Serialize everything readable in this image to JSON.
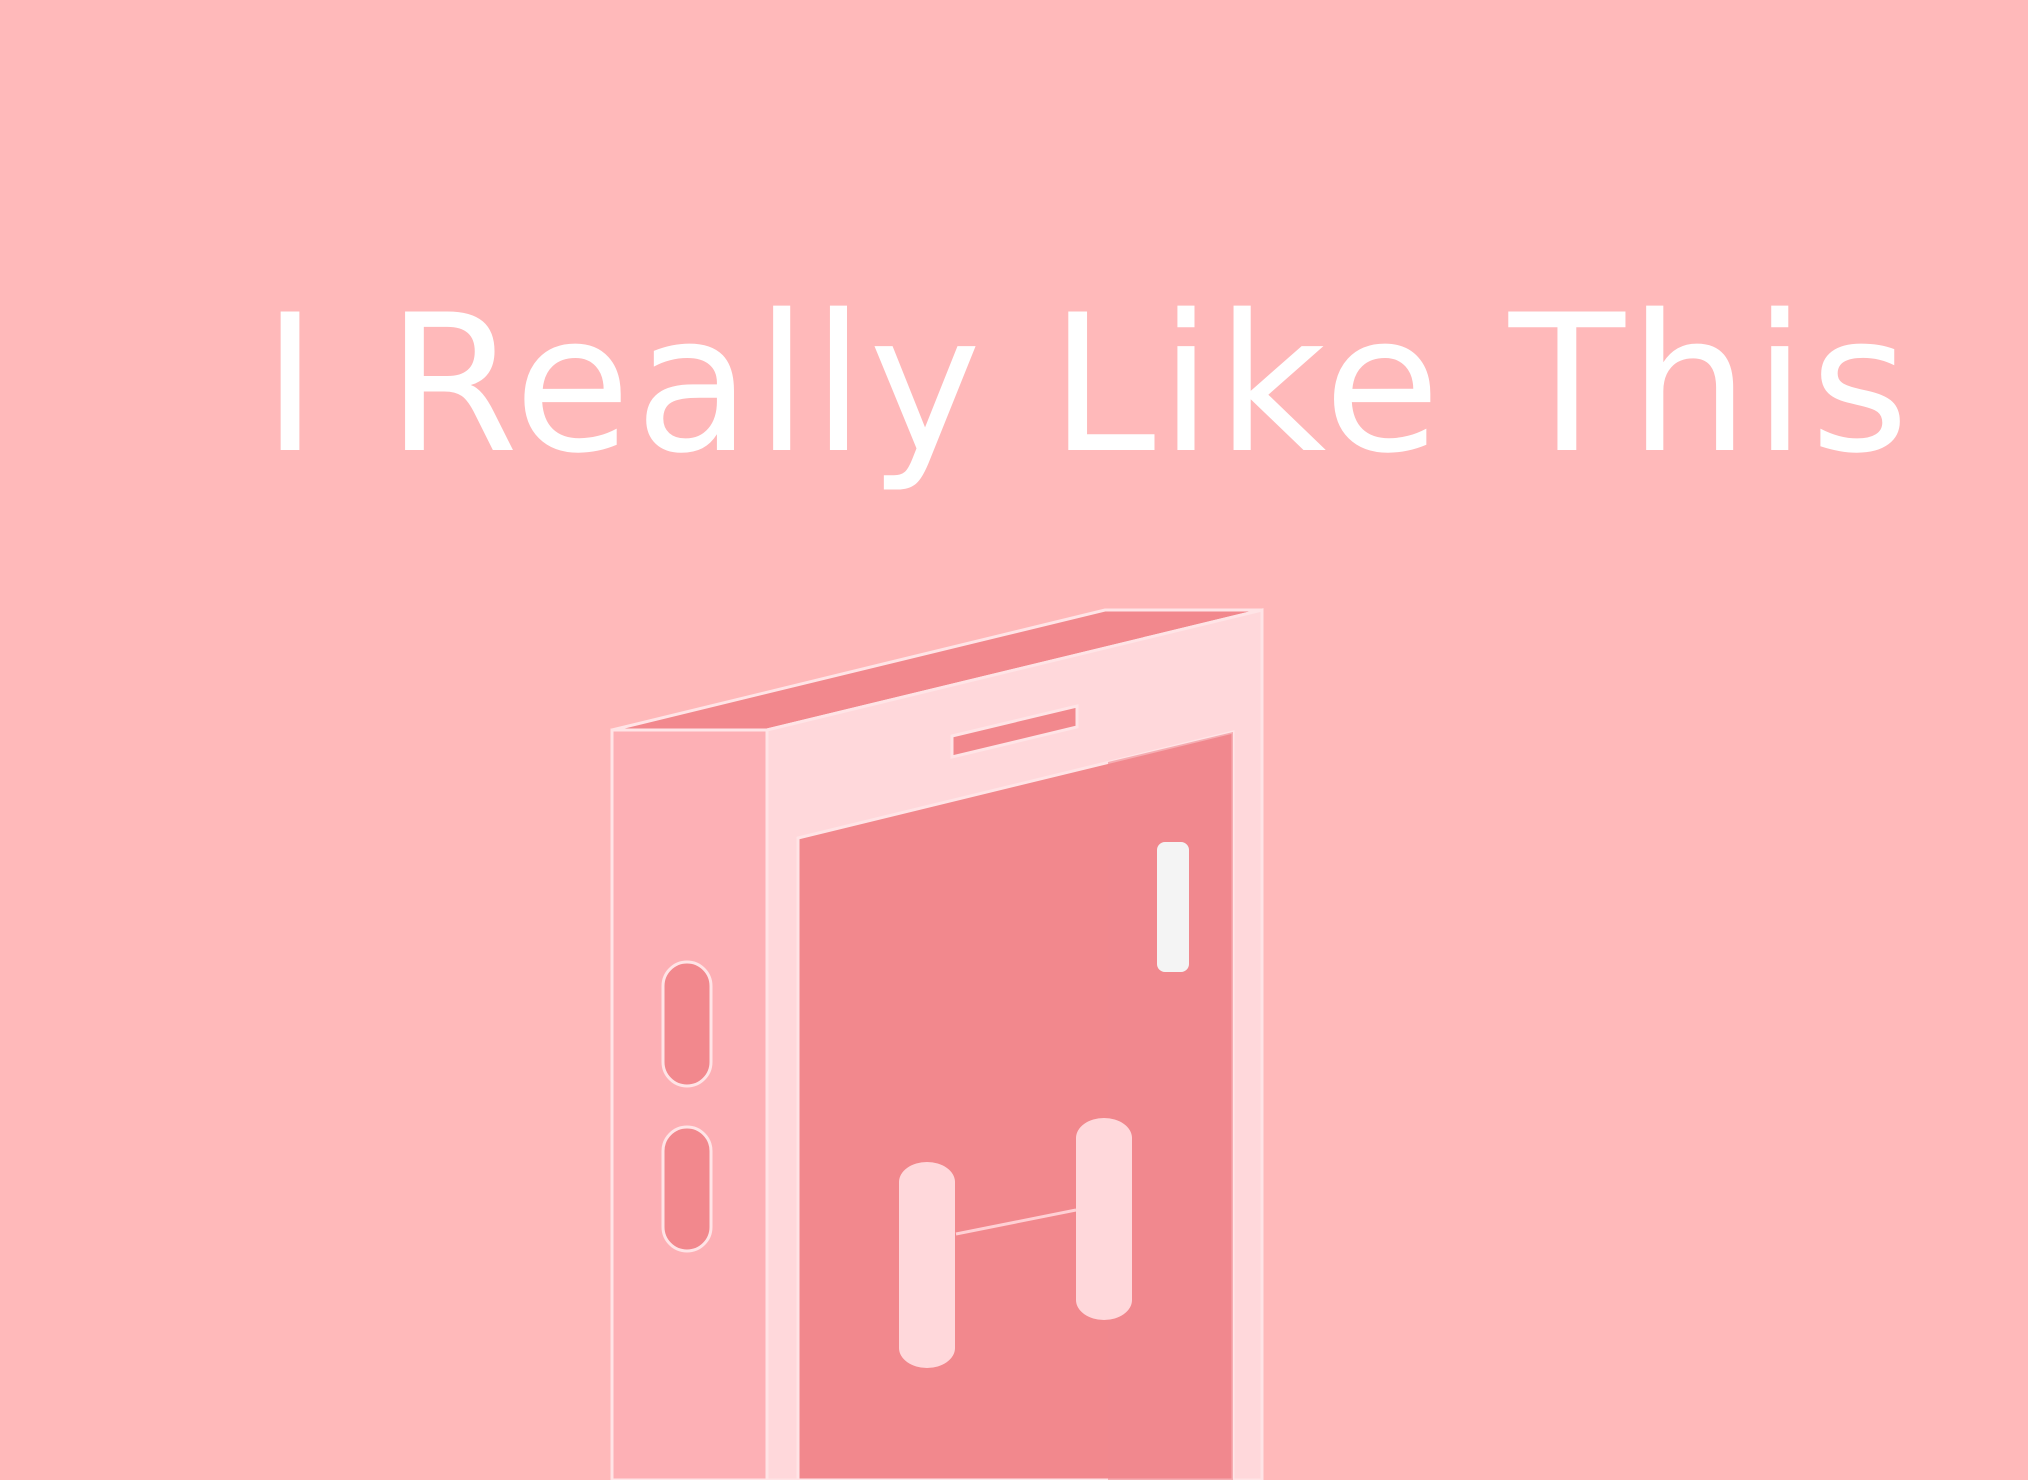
{
  "headline": {
    "text": "I Really Like This"
  },
  "colors": {
    "background": "#FFB9BA",
    "text": "#FFFFFF",
    "box_side": "#FDB0B5",
    "box_front": "#FFD8DB",
    "box_inner": "#F2888D",
    "box_top": "#F2888D",
    "outline": "#FFE4E6",
    "handle_light": "#F4F4F4"
  },
  "illustration": {
    "object": "open-box",
    "icons": [
      "side-slot-icon",
      "top-slot-icon",
      "door-handle-icon",
      "pipe-icon"
    ]
  }
}
